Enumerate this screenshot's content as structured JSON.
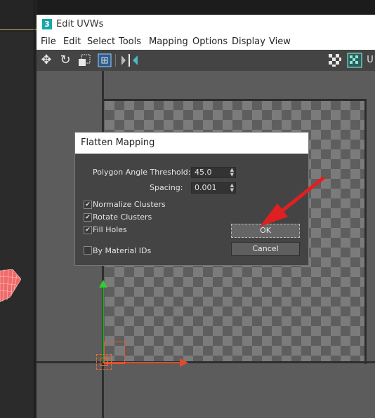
{
  "window": {
    "app_icon_text": "3",
    "title": "Edit UVWs"
  },
  "menu": [
    "File",
    "Edit",
    "Select",
    "Tools",
    "Mapping",
    "Options",
    "Display",
    "View"
  ],
  "toolbar": {
    "icons": [
      "move-icon",
      "rotate-icon",
      "scale-icon",
      "freeform-icon",
      "mirror-icon",
      "checker-map-icon",
      "uv-texture-icon"
    ],
    "trailing_label": "U"
  },
  "dialog": {
    "title": "Flatten Mapping",
    "polygon_angle_label": "Polygon Angle Threshold:",
    "polygon_angle_value": "45.0",
    "spacing_label": "Spacing:",
    "spacing_value": "0.001",
    "normalize_label": "Normalize Clusters",
    "normalize_checked": true,
    "rotate_label": "Rotate Clusters",
    "rotate_checked": true,
    "fill_holes_label": "Fill Holes",
    "fill_holes_checked": true,
    "by_material_label": "By Material IDs",
    "by_material_checked": false,
    "ok_label": "OK",
    "cancel_label": "Cancel",
    "check_glyph": "✔"
  },
  "colors": {
    "annotation_arrow": "#e02020",
    "axis_y": "#33cc33",
    "axis_x": "#e24a2a",
    "app_icon": "#1aa6a6"
  }
}
